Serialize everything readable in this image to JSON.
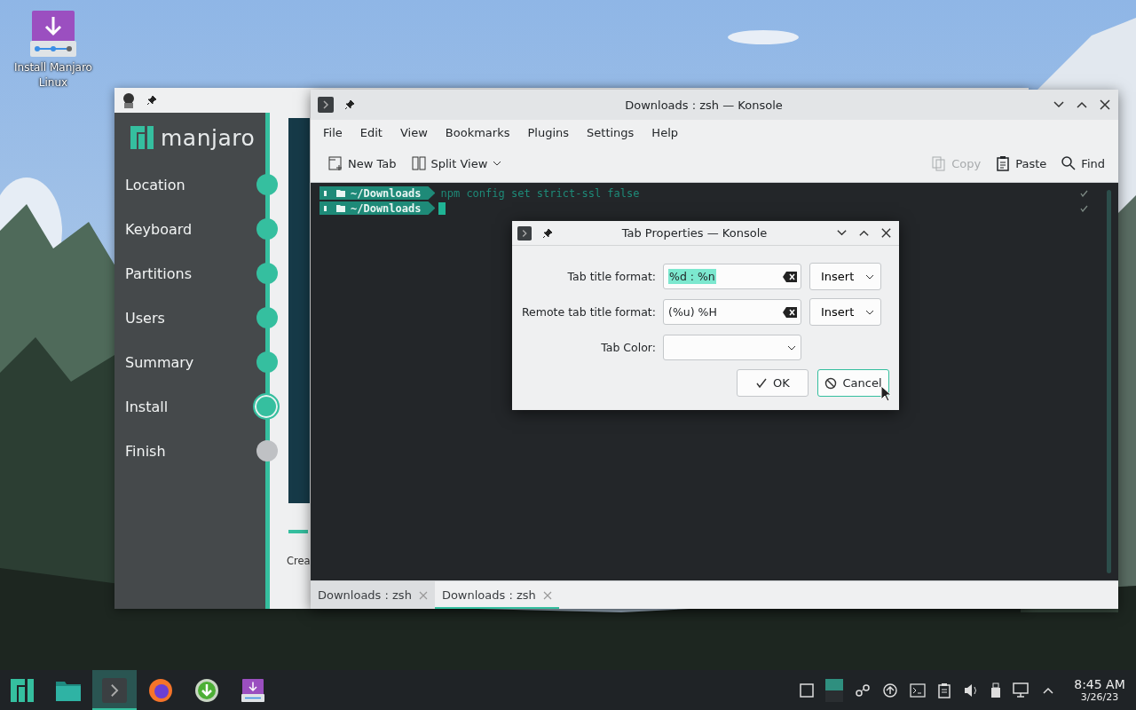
{
  "desktop": {
    "icons": [
      {
        "label": "Install Manjaro Linux"
      }
    ]
  },
  "installer": {
    "brand": "manjaro",
    "steps": [
      {
        "label": "Location",
        "done": true,
        "selected": false
      },
      {
        "label": "Keyboard",
        "done": true,
        "selected": false
      },
      {
        "label": "Partitions",
        "done": true,
        "selected": false
      },
      {
        "label": "Users",
        "done": true,
        "selected": false
      },
      {
        "label": "Summary",
        "done": true,
        "selected": false
      },
      {
        "label": "Install",
        "done": false,
        "selected": true
      },
      {
        "label": "Finish",
        "done": false,
        "selected": false
      }
    ],
    "content_text": "Crea"
  },
  "konsole": {
    "title": "Downloads : zsh — Konsole",
    "menu": [
      "File",
      "Edit",
      "View",
      "Bookmarks",
      "Plugins",
      "Settings",
      "Help"
    ],
    "toolbar_left": [
      {
        "kind": "new-tab",
        "label": "New Tab"
      },
      {
        "kind": "split",
        "label": "Split View"
      }
    ],
    "toolbar_right": [
      {
        "kind": "copy",
        "label": "Copy",
        "disabled": true
      },
      {
        "kind": "paste",
        "label": "Paste",
        "disabled": false
      },
      {
        "kind": "find",
        "label": "Find",
        "disabled": false
      }
    ],
    "terminal": {
      "lines": [
        {
          "path": "~/Downloads",
          "command": "npm config set strict-ssl false"
        },
        {
          "path": "~/Downloads",
          "cursor": true
        }
      ]
    },
    "tabs": [
      {
        "label": "Downloads : zsh",
        "selected": false
      },
      {
        "label": "Downloads : zsh",
        "selected": true
      }
    ]
  },
  "dialog": {
    "title": "Tab Properties — Konsole",
    "fields": [
      {
        "kind": "text",
        "label": "Tab title format:",
        "value": "%d : %n",
        "selected": true,
        "button": "Insert"
      },
      {
        "kind": "text",
        "label": "Remote tab title format:",
        "value": "(%u) %H",
        "selected": false,
        "button": "Insert"
      },
      {
        "kind": "color",
        "label": "Tab Color:"
      }
    ],
    "buttons": [
      {
        "kind": "ok",
        "label": "OK",
        "selected": false
      },
      {
        "kind": "cancel",
        "label": "Cancel",
        "selected": true
      }
    ]
  },
  "taskbar": {
    "apps": [
      {
        "kind": "menu",
        "selected": false
      },
      {
        "kind": "files",
        "selected": false
      },
      {
        "kind": "terminal",
        "selected": true
      },
      {
        "kind": "browser",
        "selected": false
      },
      {
        "kind": "download",
        "selected": false
      },
      {
        "kind": "installer",
        "selected": false
      }
    ],
    "clock": {
      "time": "8:45 AM",
      "date": "3/26/23"
    }
  }
}
